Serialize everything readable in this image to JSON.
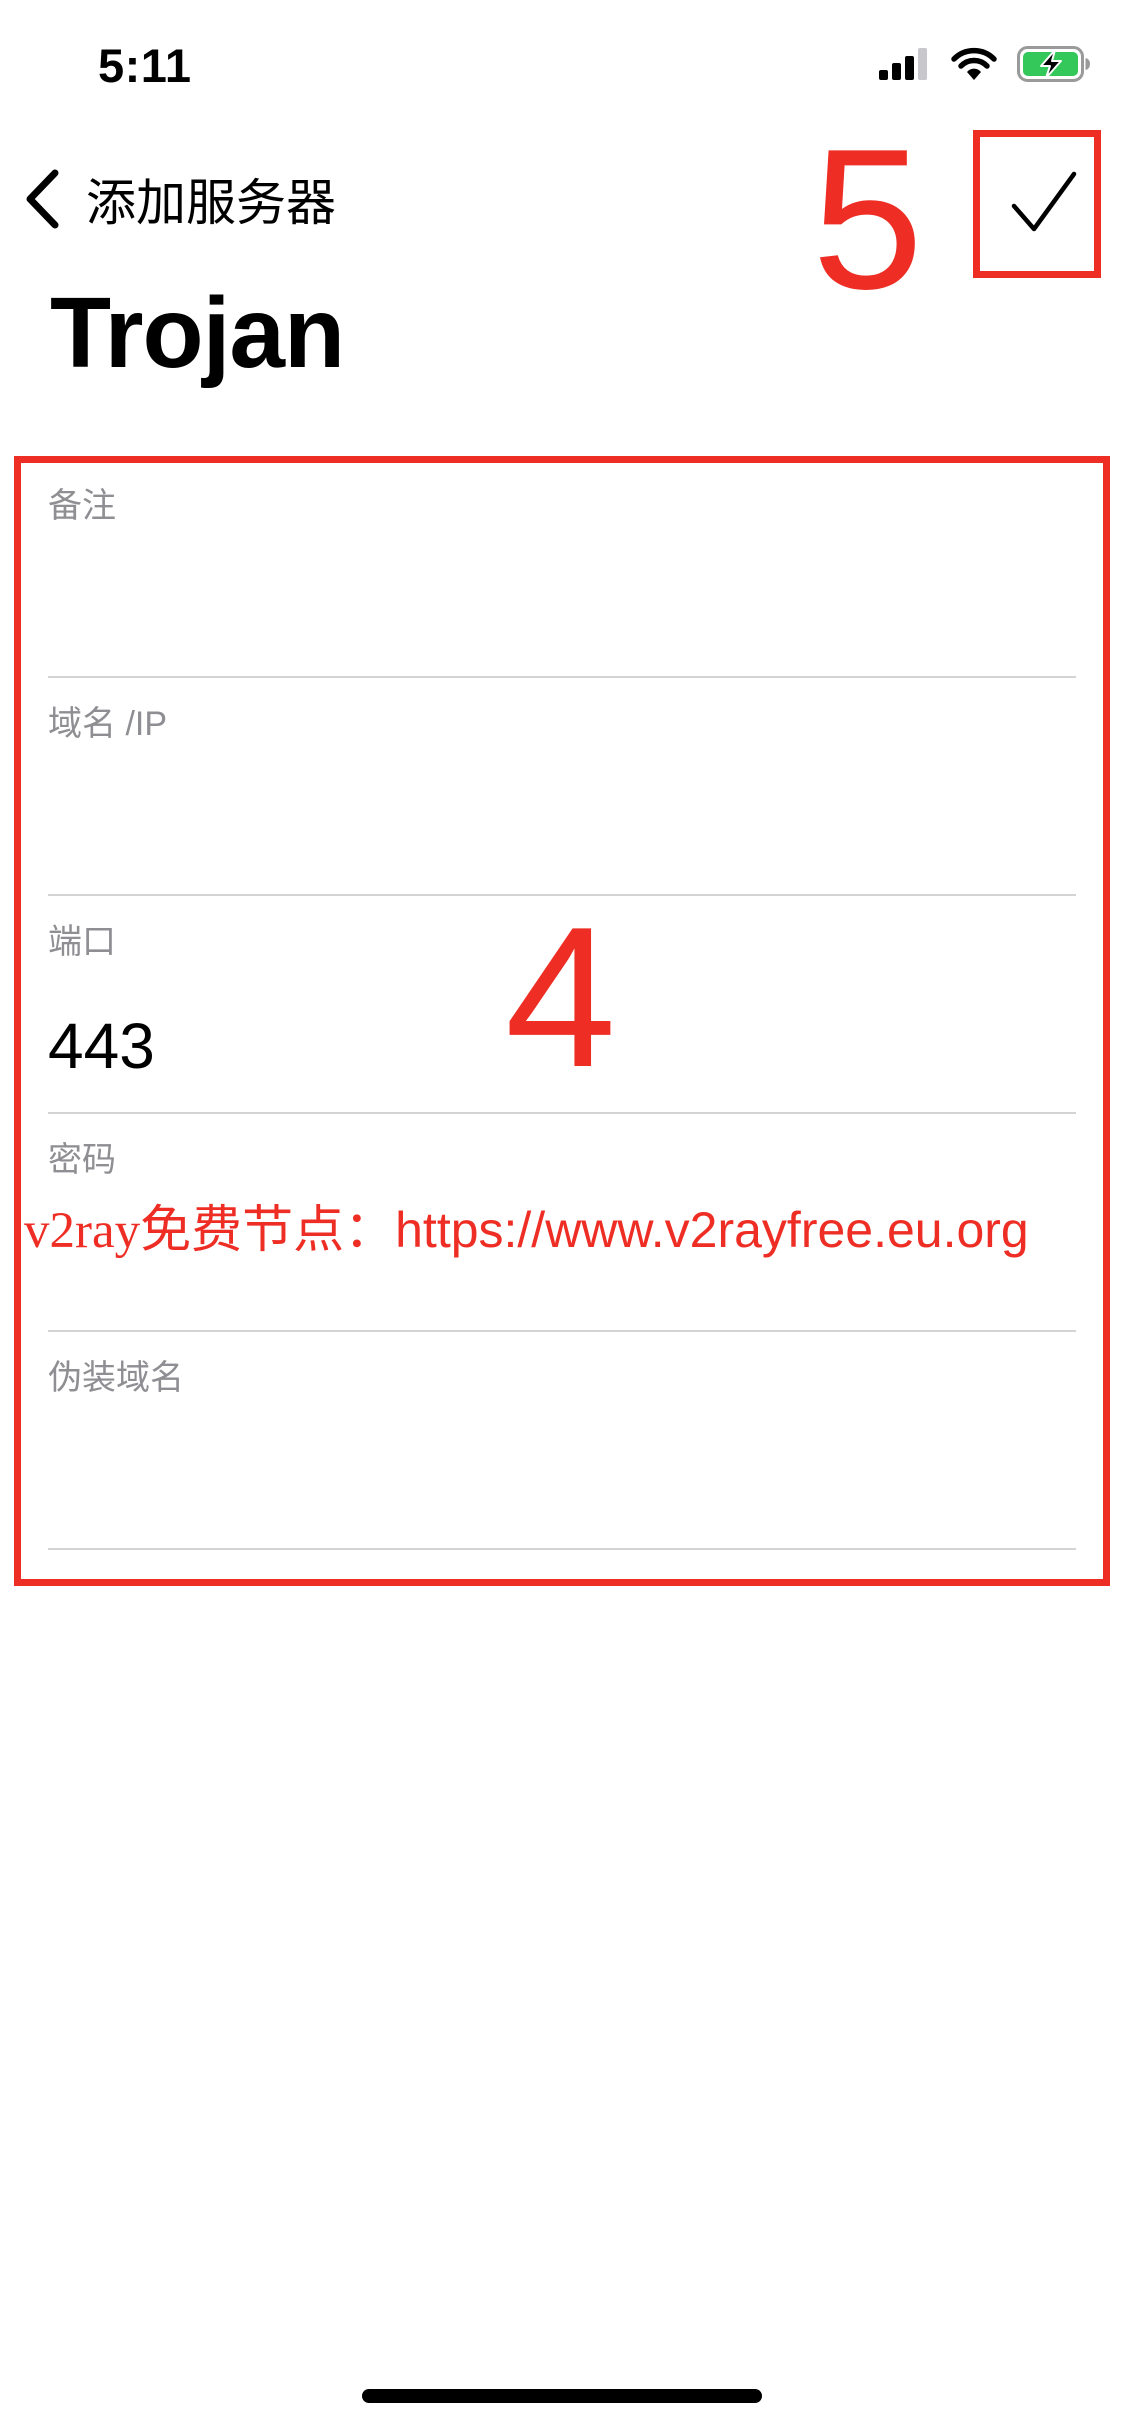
{
  "status_bar": {
    "time": "5:11",
    "icons": [
      "cellular-signal-icon",
      "wifi-icon",
      "battery-charging-icon"
    ]
  },
  "nav": {
    "back_label": "添加服务器",
    "back_icon": "chevron-left-icon",
    "done_icon": "checkmark-icon"
  },
  "page_title": "Trojan",
  "form": {
    "fields": [
      {
        "label": "备注",
        "value": "",
        "placeholder": ""
      },
      {
        "label": "域名 /IP",
        "value": "",
        "placeholder": ""
      },
      {
        "label": "端口",
        "value": "443",
        "placeholder": ""
      },
      {
        "label": "密码",
        "value": "",
        "placeholder": ""
      },
      {
        "label": "伪装域名",
        "value": "",
        "placeholder": ""
      }
    ]
  },
  "annotations": {
    "form_step": "4",
    "done_step": "5",
    "watermark_prefix": "v2ray免费节点：",
    "watermark_url": "https://www.v2rayfree.eu.org"
  },
  "colors": {
    "annotation_red": "#ee2e24",
    "label_gray": "#8e8e93",
    "separator": "#d4d4d4",
    "battery_green": "#34c759"
  }
}
